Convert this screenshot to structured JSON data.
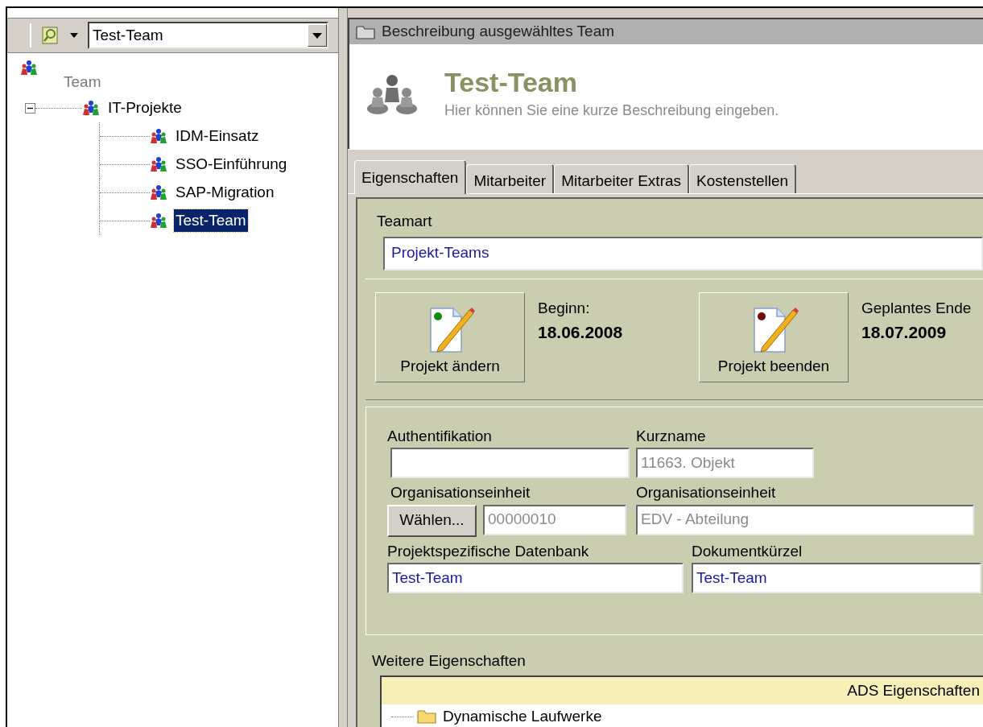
{
  "combo": {
    "value": "Test-Team"
  },
  "tree": {
    "root": {
      "label": "Team"
    },
    "items": [
      {
        "label": "IT-Projekte",
        "expanded": true,
        "selected": false,
        "children": [
          {
            "label": "IDM-Einsatz",
            "selected": false
          },
          {
            "label": "SSO-Einführung",
            "selected": false
          },
          {
            "label": "SAP-Migration",
            "selected": false
          },
          {
            "label": "Test-Team",
            "selected": true
          }
        ]
      }
    ]
  },
  "panel_title": "Beschreibung ausgewähltes Team",
  "header": {
    "title": "Test-Team",
    "description": "Hier können Sie eine kurze Beschreibung eingeben."
  },
  "tabs": [
    {
      "label": "Eigenschaften",
      "selected": true
    },
    {
      "label": "Mitarbeiter",
      "selected": false
    },
    {
      "label": "Mitarbeiter Extras",
      "selected": false
    },
    {
      "label": "Kostenstellen",
      "selected": false
    }
  ],
  "teamart": {
    "label": "Teamart",
    "value": "Projekt-Teams"
  },
  "actions": [
    {
      "label": "Projekt ändern",
      "color": "#108a10",
      "date_label": "Beginn:",
      "date": "18.06.2008"
    },
    {
      "label": "Projekt beenden",
      "color": "#7a0a0a",
      "date_label": "Geplantes Ende",
      "date": "18.07.2009"
    }
  ],
  "fields": [
    {
      "label": "Authentifikation"
    },
    {
      "label": "Kurzname",
      "value": "11663. Objekt",
      "disabled": true
    },
    {
      "label": "Organisationseinheit",
      "button": "Wählen...",
      "value": "00000010",
      "disabled": true
    },
    {
      "label": "Organisationseinheit",
      "value": "EDV - Abteilung",
      "disabled": true
    },
    {
      "label": "Projektspezifische Datenbank",
      "value": "Test-Team",
      "disabled": false
    },
    {
      "label": "Dokumentkürzel",
      "value": "Test-Team",
      "disabled": false
    }
  ],
  "more": {
    "label": "Weitere Eigenschaften",
    "column": "ADS Eigenschaften",
    "rows": [
      "Dynamische Laufwerke"
    ]
  }
}
